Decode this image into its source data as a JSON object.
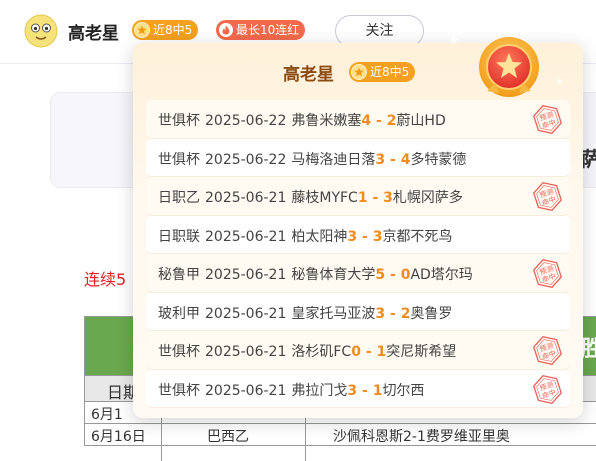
{
  "header": {
    "username": "高老星",
    "streak_badge": "近8中5",
    "fire_badge": "最长10连红",
    "follow_label": "关注"
  },
  "background": {
    "card_edge_text": "萨",
    "red_text": "连续5",
    "table": {
      "head_edge_text": "胜",
      "gray_row_text": "日期",
      "rows": [
        {
          "c1": "6月1",
          "c2": "",
          "c3": ""
        },
        {
          "c1": "6月16日",
          "c2": "巴西乙",
          "c3": "沙佩科恩斯2-1费罗维亚里奥"
        }
      ]
    }
  },
  "popup": {
    "title": "高老星",
    "badge": "近8中5",
    "stamp_text": "预测命中",
    "matches": [
      {
        "league": "世俱杯",
        "date": "2025-06-22",
        "home": "弗鲁米嫩塞",
        "hs": "4",
        "as": "2",
        "away": "蔚山HD",
        "hit": true
      },
      {
        "league": "世俱杯",
        "date": "2025-06-22",
        "home": "马梅洛迪日落",
        "hs": "3",
        "as": "4",
        "away": "多特蒙德",
        "hit": false
      },
      {
        "league": "日职乙",
        "date": "2025-06-21",
        "home": "藤枝MYFC",
        "hs": "1",
        "as": "3",
        "away": "札幌冈萨多",
        "hit": true
      },
      {
        "league": "日职联",
        "date": "2025-06-21",
        "home": "柏太阳神",
        "hs": "3",
        "as": "3",
        "away": "京都不死鸟",
        "hit": false
      },
      {
        "league": "秘鲁甲",
        "date": "2025-06-21",
        "home": "秘鲁体育大学",
        "hs": "5",
        "as": "0",
        "away": "AD塔尔玛",
        "hit": true
      },
      {
        "league": "玻利甲",
        "date": "2025-06-21",
        "home": "皇家托马亚波",
        "hs": "3",
        "as": "2",
        "away": "奥鲁罗",
        "hit": false
      },
      {
        "league": "世俱杯",
        "date": "2025-06-21",
        "home": "洛杉矶FC",
        "hs": "0",
        "as": "1",
        "away": "突尼斯希望",
        "hit": true
      },
      {
        "league": "世俱杯",
        "date": "2025-06-21",
        "home": "弗拉门戈",
        "hs": "3",
        "as": "1",
        "away": "切尔西",
        "hit": true
      }
    ]
  },
  "colors": {
    "accent_orange": "#f5a01e",
    "score_orange": "#f08c1e",
    "fire_red": "#f26a4b",
    "stamp_red": "#e8605a"
  }
}
